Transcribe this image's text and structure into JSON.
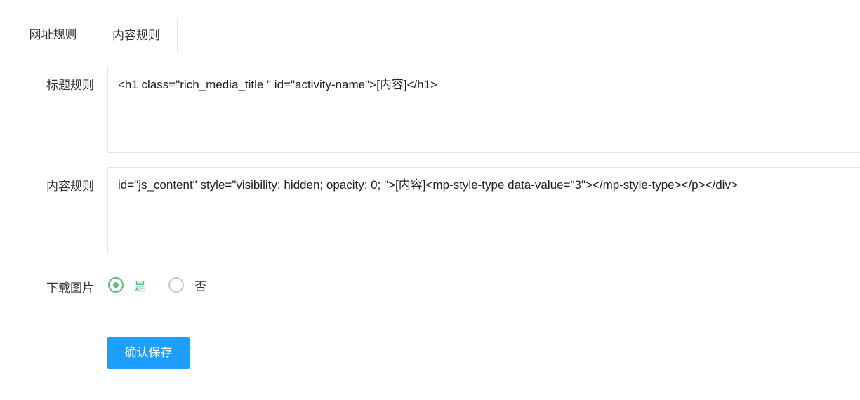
{
  "tabs": [
    {
      "label": "网址规则",
      "active": false
    },
    {
      "label": "内容规则",
      "active": true
    }
  ],
  "form": {
    "title_rule": {
      "label": "标题规则",
      "value": "<h1 class=\"rich_media_title \" id=\"activity-name\">[内容]</h1>"
    },
    "content_rule": {
      "label": "内容规则",
      "value": "id=\"js_content\" style=\"visibility: hidden; opacity: 0; \">[内容]<mp-style-type data-value=\"3\"></mp-style-type></p></div>"
    },
    "download_images": {
      "label": "下载图片",
      "options": [
        {
          "label": "是",
          "checked": true
        },
        {
          "label": "否",
          "checked": false
        }
      ]
    }
  },
  "save_button": {
    "label": "确认保存"
  },
  "colors": {
    "accent_green": "#5fb878",
    "primary_blue": "#1e9fff",
    "border": "#e6e6e6"
  }
}
